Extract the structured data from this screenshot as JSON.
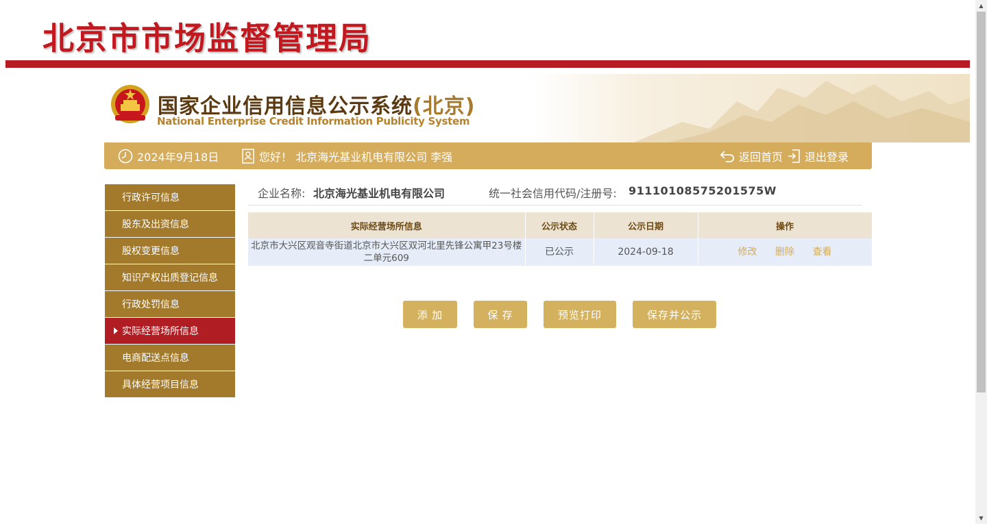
{
  "header": {
    "bureau_title": "北京市市场监督管理局",
    "system_title_cn": "国家企业信用信息公示系统",
    "system_title_region": "(北京)",
    "system_title_en": "National Enterprise Credit Information Publicity System"
  },
  "info_bar": {
    "date": "2024年9月18日",
    "greeting": "您好！ 北京海光基业机电有限公司  李强",
    "home_label": "返回首页",
    "logout_label": "退出登录"
  },
  "sidebar": {
    "items": [
      {
        "label": "行政许可信息",
        "active": false
      },
      {
        "label": "股东及出资信息",
        "active": false
      },
      {
        "label": "股权变更信息",
        "active": false
      },
      {
        "label": "知识产权出质登记信息",
        "active": false
      },
      {
        "label": "行政处罚信息",
        "active": false
      },
      {
        "label": "实际经营场所信息",
        "active": true
      },
      {
        "label": "电商配送点信息",
        "active": false
      },
      {
        "label": "具体经营项目信息",
        "active": false
      }
    ]
  },
  "company": {
    "name_label": "企业名称:",
    "name": "北京海光基业机电有限公司",
    "code_label": "统一社会信用代码/注册号:",
    "code": "91110108575201575W"
  },
  "table": {
    "columns": [
      "实际经营场所信息",
      "公示状态",
      "公示日期",
      "操作"
    ],
    "rows": [
      {
        "address": "北京市大兴区观音寺街道北京市大兴区双河北里先锋公寓甲23号楼二单元609",
        "status": "已公示",
        "date": "2024-09-18",
        "actions": [
          "修改",
          "删除",
          "查看"
        ]
      }
    ]
  },
  "buttons": {
    "add": "添 加",
    "save": "保 存",
    "preview": "预览打印",
    "save_publish": "保存并公示"
  },
  "colors": {
    "brand_red": "#b71c24",
    "gold": "#d4ac5c",
    "sidebar_brown": "#a37a2c",
    "active_red": "#b01d22"
  }
}
